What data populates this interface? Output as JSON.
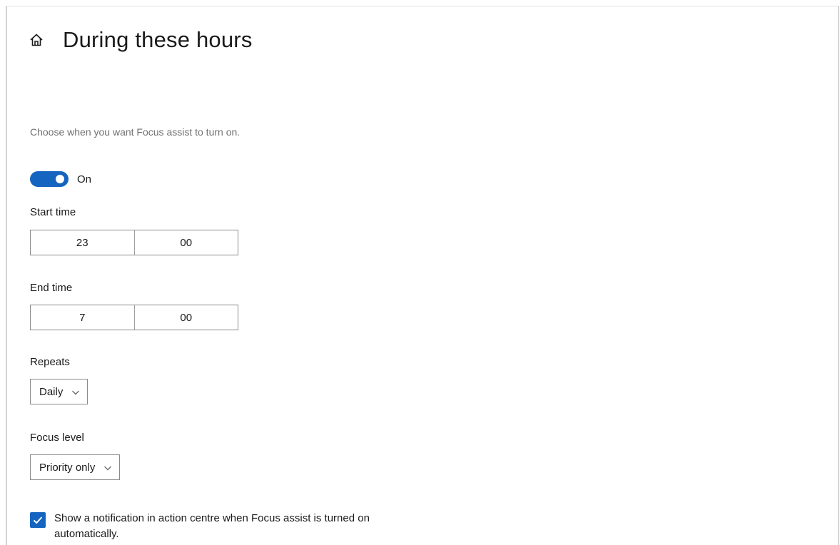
{
  "header": {
    "title": "During these hours",
    "icon": "home-icon"
  },
  "description": "Choose when you want Focus assist to turn on.",
  "toggle": {
    "state": "On",
    "is_on": true,
    "accent_color": "#1565c0"
  },
  "start_time": {
    "label": "Start time",
    "hour": "23",
    "minute": "00"
  },
  "end_time": {
    "label": "End time",
    "hour": "7",
    "minute": "00"
  },
  "repeats": {
    "label": "Repeats",
    "selected": "Daily"
  },
  "focus_level": {
    "label": "Focus level",
    "selected": "Priority only"
  },
  "notification_checkbox": {
    "checked": true,
    "label": "Show a notification in action centre when Focus assist is turned on automatically."
  }
}
